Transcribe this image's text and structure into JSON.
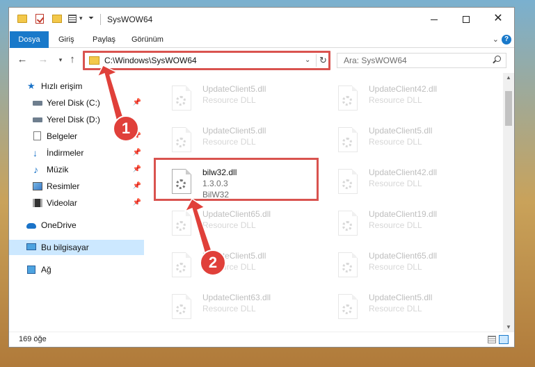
{
  "window": {
    "title": "SysWOW64"
  },
  "ribbon": {
    "tabs": [
      "Dosya",
      "Giriş",
      "Paylaş",
      "Görünüm"
    ],
    "help": "?"
  },
  "address": {
    "path": "C:\\Windows\\SysWOW64",
    "search_placeholder": "Ara: SysWOW64"
  },
  "nav": {
    "items": [
      {
        "label": "Hızlı erişim",
        "icon": "star-icon"
      },
      {
        "label": "Yerel Disk (C:)",
        "icon": "drive-icon"
      },
      {
        "label": "Yerel Disk (D:)",
        "icon": "drive-icon"
      },
      {
        "label": "Belgeler",
        "icon": "documents-icon"
      },
      {
        "label": "İndirmeler",
        "icon": "download-icon"
      },
      {
        "label": "Müzik",
        "icon": "music-icon"
      },
      {
        "label": "Resimler",
        "icon": "pictures-icon"
      },
      {
        "label": "Videolar",
        "icon": "videos-icon"
      },
      {
        "label": "OneDrive",
        "icon": "cloud-icon"
      },
      {
        "label": "Bu bilgisayar",
        "icon": "computer-icon"
      },
      {
        "label": "Ağ",
        "icon": "network-icon"
      }
    ]
  },
  "files": {
    "left": [
      {
        "name": "UpdateClient5.dll",
        "meta1": "Resource DLL"
      },
      {
        "name": "UpdateClient5.dll",
        "meta1": "Resource DLL"
      },
      {
        "name": "bilw32.dll",
        "meta1": "1.3.0.3",
        "meta2": "BilW32"
      },
      {
        "name": "UpdateClient65.dll",
        "meta1": "Resource DLL"
      },
      {
        "name": "UpdateClient5.dll",
        "meta1": "Resource DLL"
      },
      {
        "name": "UpdateClient63.dll",
        "meta1": "Resource DLL"
      }
    ],
    "right": [
      {
        "name": "UpdateClient42.dll",
        "meta1": "Resource DLL"
      },
      {
        "name": "UpdateClient5.dll",
        "meta1": "Resource DLL"
      },
      {
        "name": "UpdateClient42.dll",
        "meta1": "Resource DLL"
      },
      {
        "name": "UpdateClient19.dll",
        "meta1": "Resource DLL"
      },
      {
        "name": "UpdateClient65.dll",
        "meta1": "Resource DLL"
      },
      {
        "name": "UpdateClient5.dll",
        "meta1": "Resource DLL"
      }
    ]
  },
  "status": {
    "count": "169 öğe"
  },
  "annotations": {
    "badge1": "1",
    "badge2": "2",
    "color": "#e0403a"
  }
}
